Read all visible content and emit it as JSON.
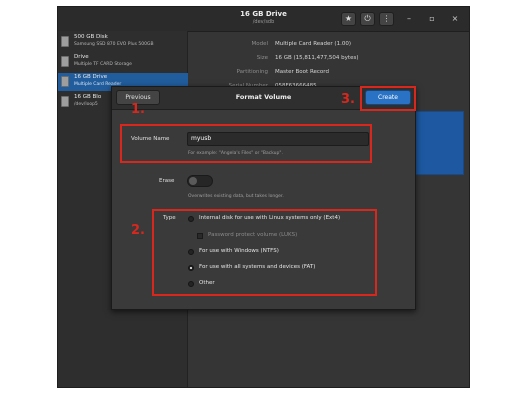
{
  "window": {
    "title": "16 GB Drive",
    "subtitle": "/dev/sdb",
    "controls": {
      "star_icon": "star-icon",
      "power_icon": "power-icon",
      "menu_icon": "kebab-menu-icon",
      "minimize": "–",
      "maximize": "▫",
      "close": "×"
    }
  },
  "sidebar": {
    "drives": [
      {
        "name": "500 GB Disk",
        "desc": "Samsung SSD 870 EVO Plus 500GB",
        "selected": false
      },
      {
        "name": "Drive",
        "desc": "Multiple TF CARD Storage",
        "selected": false
      },
      {
        "name": "16 GB Drive",
        "desc": "Multiple Card Reader",
        "selected": true
      },
      {
        "name": "16 GB Blo",
        "desc": "/dev/loop5",
        "selected": false
      }
    ]
  },
  "properties": [
    {
      "label": "Model",
      "value": "Multiple Card Reader (1.00)"
    },
    {
      "label": "Size",
      "value": "16 GB (15,811,477,504 bytes)"
    },
    {
      "label": "Partitioning",
      "value": "Master Boot Record"
    },
    {
      "label": "Serial Number",
      "value": "058F63666485"
    }
  ],
  "dialog": {
    "title": "Format Volume",
    "previous_label": "Previous",
    "create_label": "Create",
    "volume_name_label": "Volume Name",
    "volume_name_value": "myusb",
    "volume_name_hint": "For example: \"Angela's Files\" or \"Backup\".",
    "erase_label": "Erase",
    "erase_hint": "Overwrites existing data, but takes longer.",
    "type_label": "Type",
    "type_options": [
      {
        "label": "Internal disk for use with Linux systems only (Ext4)",
        "checked": false,
        "dim": false
      },
      {
        "label": "Password protect volume (LUKS)",
        "checked": false,
        "dim": true,
        "checkbox": true
      },
      {
        "label": "For use with Windows (NTFS)",
        "checked": false,
        "dim": false
      },
      {
        "label": "For use with all systems and devices (FAT)",
        "checked": true,
        "dim": false
      },
      {
        "label": "Other",
        "checked": false,
        "dim": false
      }
    ]
  },
  "annotations": {
    "one": "1.",
    "two": "2.",
    "three": "3.",
    "color": "#d8281e"
  }
}
